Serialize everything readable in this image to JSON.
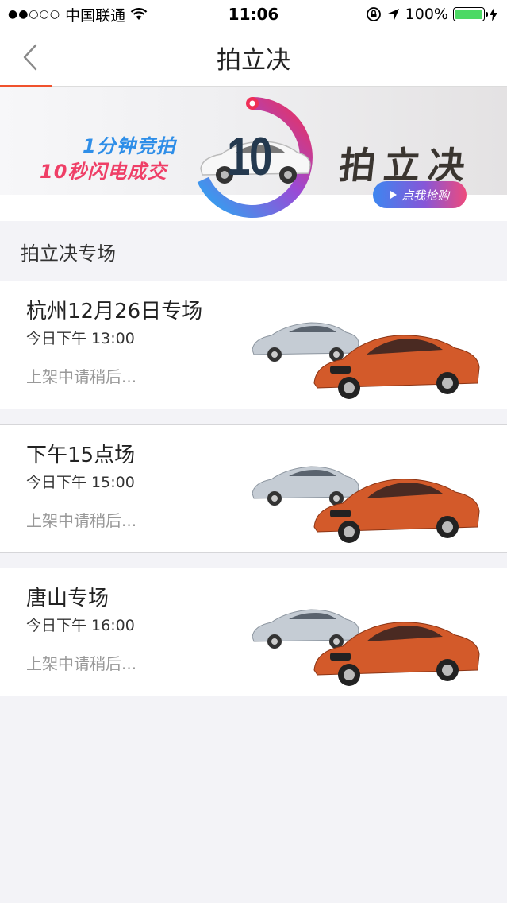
{
  "status_bar": {
    "carrier": "中国联通",
    "time": "11:06",
    "battery": "100%"
  },
  "nav": {
    "title": "拍立决"
  },
  "banner": {
    "promo_line1": "1分钟竞拍",
    "promo_line2": "10秒闪电成交",
    "countdown": "10",
    "brand": "拍立决",
    "cta": "点我抢购"
  },
  "section": {
    "title": "拍立决专场"
  },
  "sessions": [
    {
      "name": "杭州12月26日专场",
      "time": "今日下午 13:00",
      "status": "上架中请稍后..."
    },
    {
      "name": "下午15点场",
      "time": "今日下午 15:00",
      "status": "上架中请稍后..."
    },
    {
      "name": "唐山专场",
      "time": "今日下午 16:00",
      "status": "上架中请稍后..."
    }
  ],
  "colors": {
    "accent": "#f0522d",
    "promo_blue": "#2e8ee8",
    "promo_pink": "#ef3f67",
    "battery_green": "#4cd964"
  }
}
